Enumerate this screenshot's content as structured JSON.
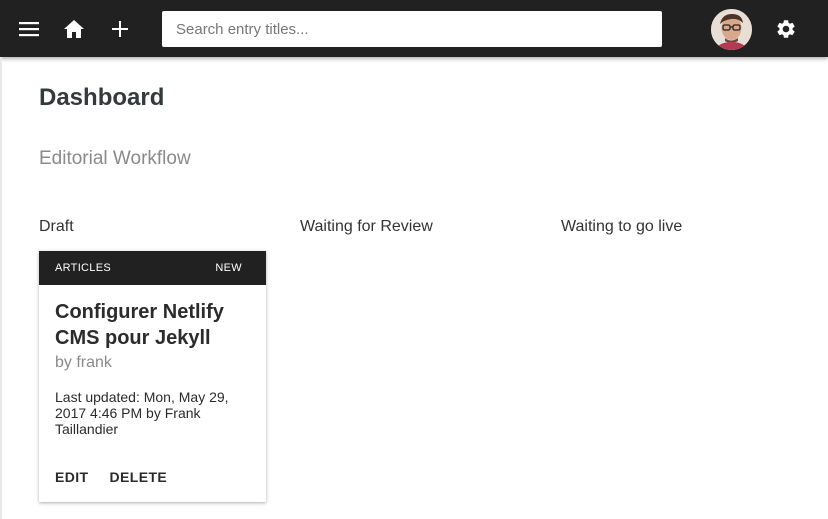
{
  "appbar": {
    "search": {
      "placeholder": "Search entry titles...",
      "value": ""
    },
    "icons": [
      "menu-icon",
      "home-icon",
      "plus-icon",
      "settings-icon"
    ],
    "background": "#212121"
  },
  "page": {
    "title": "Dashboard",
    "subtitle": "Editorial Workflow"
  },
  "columns": [
    {
      "label": "Draft"
    },
    {
      "label": "Waiting for Review"
    },
    {
      "label": "Waiting to go live"
    }
  ],
  "card": {
    "collection": "ARTICLES",
    "badge": "NEW",
    "title": "Configurer Netlify CMS pour Jekyll",
    "author": "by frank",
    "updated": "Last updated: Mon, May 29, 2017 4:46 PM by Frank Taillandier",
    "edit_label": "EDIT",
    "delete_label": "DELETE"
  }
}
